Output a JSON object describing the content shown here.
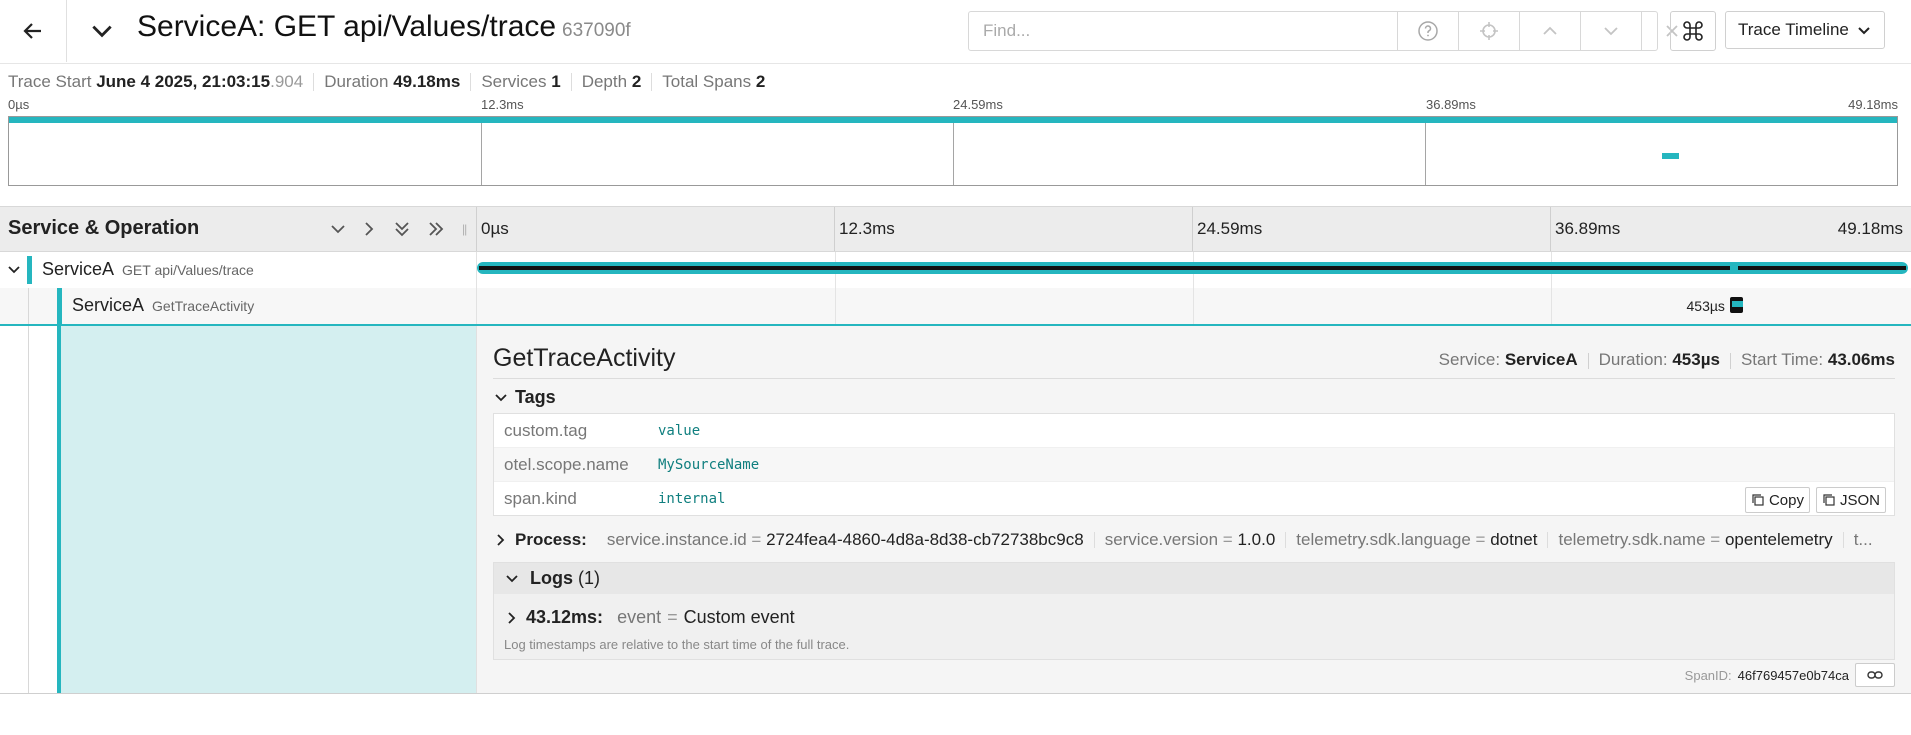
{
  "header": {
    "title": "ServiceA: GET api/Values/trace",
    "trace_id": "637090f",
    "find_placeholder": "Find...",
    "view_select": "Trace Timeline"
  },
  "summary": {
    "trace_start_label": "Trace Start",
    "trace_start_value": "June 4 2025, 21:03:15",
    "trace_start_ms": ".904",
    "duration_label": "Duration",
    "duration_value": "49.18ms",
    "services_label": "Services",
    "services_value": "1",
    "depth_label": "Depth",
    "depth_value": "2",
    "total_spans_label": "Total Spans",
    "total_spans_value": "2"
  },
  "minimap": {
    "ticks": [
      "0µs",
      "12.3ms",
      "24.59ms",
      "36.89ms",
      "49.18ms"
    ]
  },
  "timeline": {
    "column_title": "Service & Operation",
    "ticks": [
      "0µs",
      "12.3ms",
      "24.59ms",
      "36.89ms",
      "49.18ms"
    ],
    "total_ms": 49.18
  },
  "spans": [
    {
      "service": "ServiceA",
      "operation": "GET api/Values/trace",
      "start_ms": 0,
      "duration_ms": 49.18
    },
    {
      "service": "ServiceA",
      "operation": "GetTraceActivity",
      "start_ms": 43.06,
      "duration_ms": 0.453,
      "duration_label": "453µs"
    }
  ],
  "detail": {
    "name": "GetTraceActivity",
    "service_label": "Service:",
    "service_value": "ServiceA",
    "duration_label": "Duration:",
    "duration_value": "453µs",
    "start_label": "Start Time:",
    "start_value": "43.06ms",
    "tags_label": "Tags",
    "tags": [
      {
        "key": "custom.tag",
        "value": "value"
      },
      {
        "key": "otel.scope.name",
        "value": "MySourceName"
      },
      {
        "key": "span.kind",
        "value": "internal"
      }
    ],
    "copy_label": "Copy",
    "json_label": "JSON",
    "process_label": "Process:",
    "process": [
      {
        "key": "service.instance.id",
        "value": "2724fea4-4860-4d8a-8d38-cb72738bc9c8"
      },
      {
        "key": "service.version",
        "value": "1.0.0"
      },
      {
        "key": "telemetry.sdk.language",
        "value": "dotnet"
      },
      {
        "key": "telemetry.sdk.name",
        "value": "opentelemetry"
      }
    ],
    "process_more": "t...",
    "logs_label": "Logs",
    "logs_count": "(1)",
    "log_time": "43.12ms:",
    "log_key": "event",
    "log_value": "Custom event",
    "logs_note": "Log timestamps are relative to the start time of the full trace.",
    "span_id_label": "SpanID:",
    "span_id": "46f769457e0b74ca"
  },
  "colors": {
    "accent": "#25b6bf",
    "span_bar_dark": "#111111",
    "detail_fill": "#d4eff0"
  }
}
